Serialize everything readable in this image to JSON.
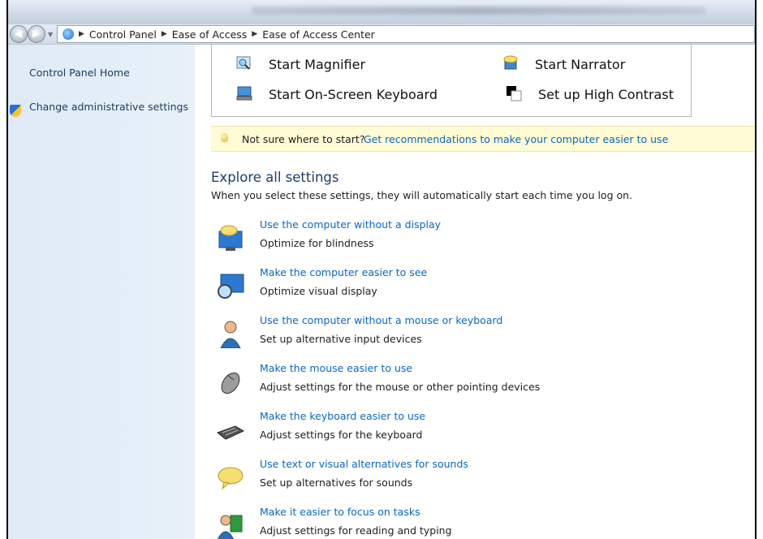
{
  "addressbar": {
    "crumbs": [
      "Control Panel",
      "Ease of Access",
      "Ease of Access Center"
    ]
  },
  "sidebar": {
    "items": [
      {
        "label": "Control Panel Home"
      },
      {
        "label": "Change administrative settings",
        "icon": "shield-icon"
      }
    ]
  },
  "quick_access": {
    "items": [
      {
        "label": "Start Magnifier",
        "icon": "magnifier-icon"
      },
      {
        "label": "Start Narrator",
        "icon": "narrator-icon"
      },
      {
        "label": "Start On-Screen Keyboard",
        "icon": "onscreen-keyboard-icon"
      },
      {
        "label": "Set up High Contrast",
        "icon": "high-contrast-icon"
      }
    ]
  },
  "tip": {
    "question": "Not sure where to start?",
    "link": "Get recommendations to make your computer easier to use",
    "icon": "lightbulb-icon"
  },
  "explore": {
    "heading": "Explore all settings",
    "subtitle": "When you select these settings, they will automatically start each time you log on.",
    "items": [
      {
        "link": "Use the computer without a display",
        "desc": "Optimize for blindness",
        "icon": "monitor-speech-icon"
      },
      {
        "link": "Make the computer easier to see",
        "desc": "Optimize visual display",
        "icon": "monitor-magnifier-icon"
      },
      {
        "link": "Use the computer without a mouse or keyboard",
        "desc": "Set up alternative input devices",
        "icon": "person-icon"
      },
      {
        "link": "Make the mouse easier to use",
        "desc": "Adjust settings for the mouse or other pointing devices",
        "icon": "mouse-icon"
      },
      {
        "link": "Make the keyboard easier to use",
        "desc": "Adjust settings for the keyboard",
        "icon": "keyboard-icon"
      },
      {
        "link": "Use text or visual alternatives for sounds",
        "desc": "Set up alternatives for sounds",
        "icon": "speech-bubble-icon"
      },
      {
        "link": "Make it easier to focus on tasks",
        "desc": "Adjust settings for reading and typing",
        "icon": "person-book-icon"
      }
    ]
  },
  "colors": {
    "link": "#0b67c2",
    "heading": "#1b3d6e",
    "sidebar_bg": "#dfeaf6",
    "tip_bg": "#fffbd5"
  }
}
